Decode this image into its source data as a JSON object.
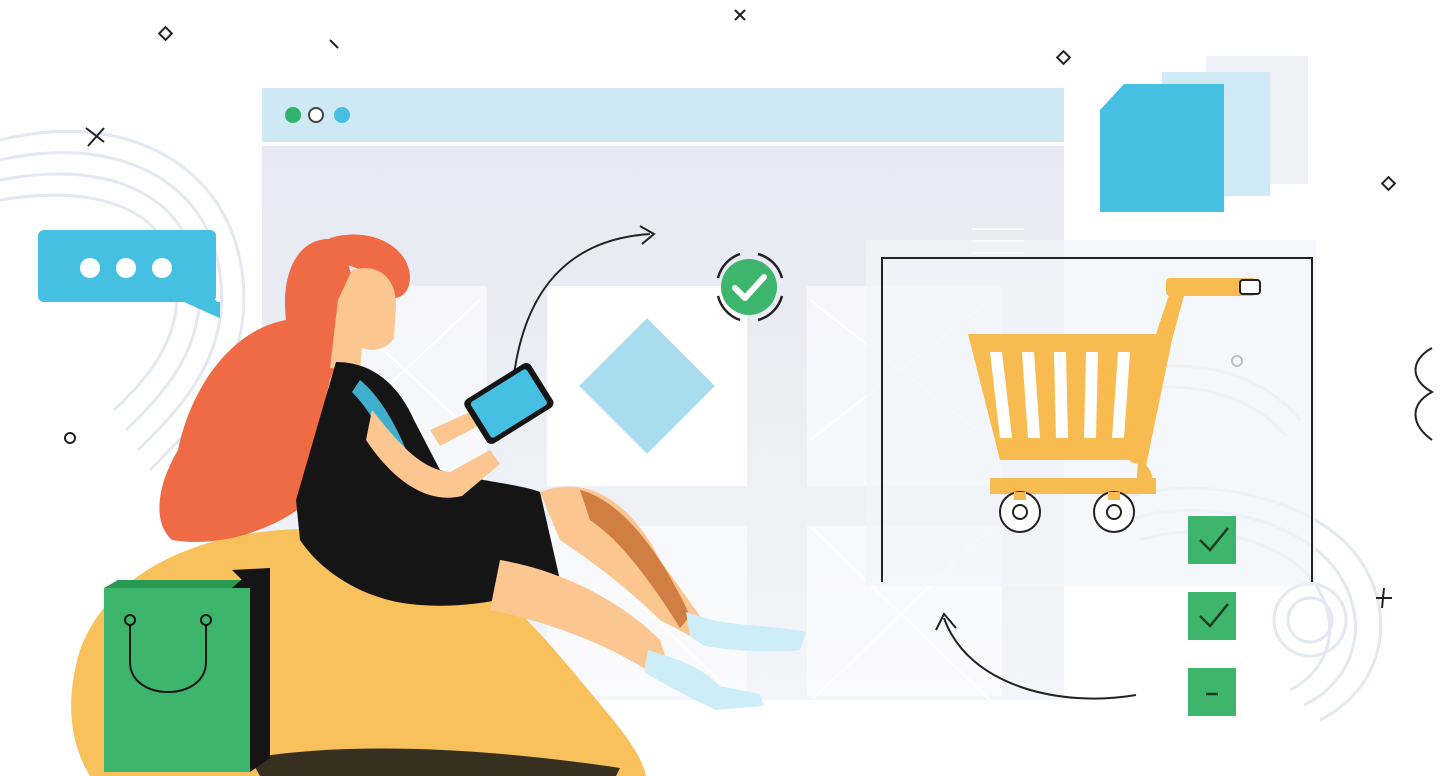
{
  "illustration": {
    "subject": "online-shopping",
    "colors": {
      "titlebar": "#cfe9f4",
      "accent_blue": "#45c0e2",
      "accent_green": "#3db56c",
      "hair": "#ef6b45",
      "cart": "#f7bb4f",
      "bean_bag": "#f9c15c",
      "dress": "#151515",
      "skin": "#fbc68f"
    },
    "window_dots": [
      "green-dot",
      "white-dot",
      "blue-dot"
    ],
    "checklist": [
      {
        "state": "checked"
      },
      {
        "state": "checked"
      },
      {
        "state": "minus"
      }
    ]
  }
}
